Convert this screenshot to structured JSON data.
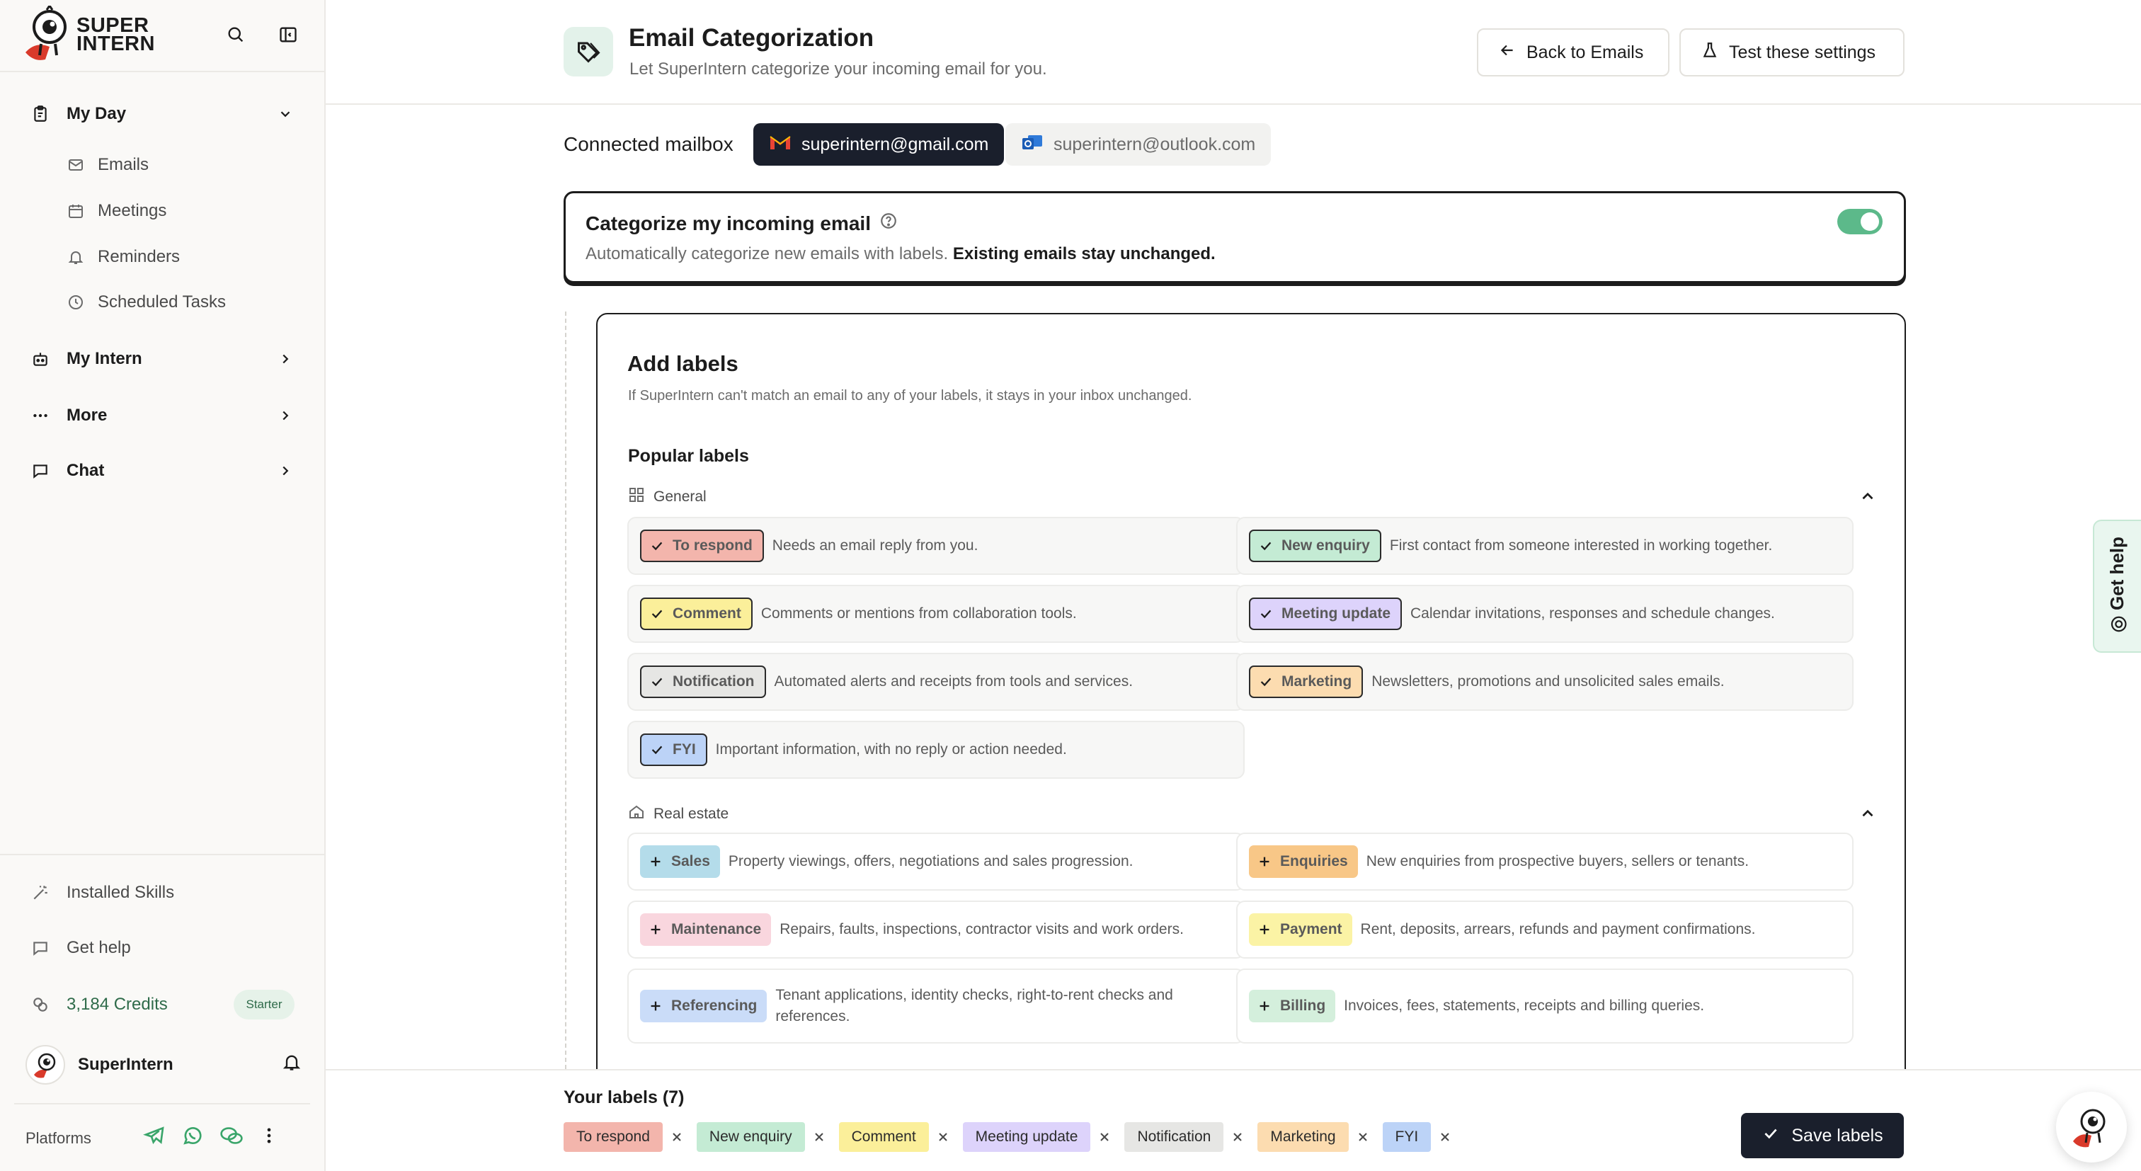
{
  "brand": {
    "line1": "SUPER",
    "line2": "INTERN"
  },
  "sidebar": {
    "my_day": "My Day",
    "sub_items": [
      "Emails",
      "Meetings",
      "Reminders",
      "Scheduled Tasks"
    ],
    "my_intern": "My Intern",
    "more": "More",
    "chat": "Chat",
    "installed_skills": "Installed Skills",
    "get_help": "Get help",
    "credits": "3,184 Credits",
    "plan": "Starter",
    "user_name": "SuperIntern",
    "platforms": "Platforms"
  },
  "header": {
    "title": "Email Categorization",
    "subtitle": "Let SuperIntern categorize your incoming email for you.",
    "back_button": "Back to Emails",
    "test_button": "Test these settings"
  },
  "mailbox": {
    "label": "Connected mailbox",
    "accounts": [
      "superintern@gmail.com",
      "superintern@outlook.com"
    ],
    "active": "superintern@gmail.com"
  },
  "toggle": {
    "title": "Categorize my incoming email",
    "desc_plain": "Automatically categorize new emails with labels. ",
    "desc_bold": "Existing emails stay unchanged.",
    "enabled": true
  },
  "labels_card": {
    "title": "Add labels",
    "description": "If SuperIntern can't match an email to any of your labels, it stays in your inbox unchanged.",
    "popular": "Popular labels",
    "sections": [
      {
        "name": "General",
        "labels": [
          {
            "name": "To respond",
            "desc": "Needs an email reply from you.",
            "color": "#f3b5ac",
            "selected": true
          },
          {
            "name": "New enquiry",
            "desc": "First contact from someone interested in working together.",
            "color": "#c4ebd4",
            "selected": true
          },
          {
            "name": "Comment",
            "desc": "Comments or mentions from collaboration tools.",
            "color": "#fbef9a",
            "selected": true
          },
          {
            "name": "Meeting update",
            "desc": "Calendar invitations, responses and schedule changes.",
            "color": "#ddd3fb",
            "selected": true
          },
          {
            "name": "Notification",
            "desc": "Automated alerts and receipts from tools and services.",
            "color": "#e6e6e4",
            "selected": true
          },
          {
            "name": "Marketing",
            "desc": "Newsletters, promotions and unsolicited sales emails.",
            "color": "#fcdcb0",
            "selected": true
          },
          {
            "name": "FYI",
            "desc": "Important information, with no reply or action needed.",
            "color": "#bcd3f7",
            "selected": true
          }
        ]
      },
      {
        "name": "Real estate",
        "labels": [
          {
            "name": "Sales",
            "desc": "Property viewings, offers, negotiations and sales progression.",
            "color": "#b4dcea",
            "selected": false
          },
          {
            "name": "Enquiries",
            "desc": "New enquiries from prospective buyers, sellers or tenants.",
            "color": "#f8c787",
            "selected": false
          },
          {
            "name": "Maintenance",
            "desc": "Repairs, faults, inspections, contractor visits and work orders.",
            "color": "#f9d6de",
            "selected": false
          },
          {
            "name": "Payment",
            "desc": "Rent, deposits, arrears, refunds and payment confirmations.",
            "color": "#fbf3a5",
            "selected": false
          },
          {
            "name": "Referencing",
            "desc": "Tenant applications, identity checks, right-to-rent checks and references.",
            "color": "#cadcf8",
            "selected": false
          },
          {
            "name": "Billing",
            "desc": "Invoices, fees, statements, receipts and billing queries.",
            "color": "#d4efdc",
            "selected": false
          }
        ]
      }
    ]
  },
  "your_labels": {
    "title": "Your labels (7)",
    "items": [
      {
        "name": "To respond",
        "color": "#f3b5ac"
      },
      {
        "name": "New enquiry",
        "color": "#c4ebd4"
      },
      {
        "name": "Comment",
        "color": "#fbef9a"
      },
      {
        "name": "Meeting update",
        "color": "#ddd3fb"
      },
      {
        "name": "Notification",
        "color": "#e6e6e4"
      },
      {
        "name": "Marketing",
        "color": "#fcdcb0"
      },
      {
        "name": "FYI",
        "color": "#bcd3f7"
      }
    ],
    "save_button": "Save labels"
  },
  "floating": {
    "get_help": "Get help"
  },
  "colors": {
    "accent_dark": "#1a1f2c",
    "toggle_on": "#5cb98a",
    "brand_red": "#d93a2b"
  },
  "icons": [
    "search-icon",
    "sidebar-toggle-icon",
    "clipboard-icon",
    "mail-icon",
    "calendar-icon",
    "bell-icon",
    "clock-icon",
    "robot-icon",
    "dots-icon",
    "chat-icon",
    "wand-icon",
    "coins-icon",
    "telegram-icon",
    "whatsapp-icon",
    "wechat-icon",
    "kebab-icon",
    "tag-icon",
    "arrow-left-icon",
    "flask-icon",
    "gmail-icon",
    "outlook-icon",
    "question-icon",
    "grid-icon",
    "home-icon",
    "check-icon",
    "plus-icon",
    "close-icon"
  ]
}
